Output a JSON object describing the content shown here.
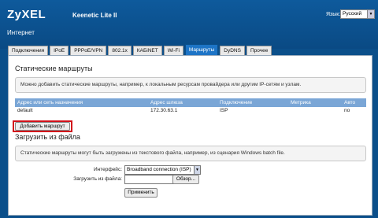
{
  "header": {
    "brand": "ZyXEL",
    "model": "Keenetic Lite II",
    "section": "Интернет",
    "language_label": "Язык:",
    "language_value": "Русский"
  },
  "tabs": [
    {
      "label": "Подключения"
    },
    {
      "label": "IPoE"
    },
    {
      "label": "PPPoE/VPN"
    },
    {
      "label": "802.1x"
    },
    {
      "label": "КАБiNET"
    },
    {
      "label": "Wi-Fi"
    },
    {
      "label": "Маршруты",
      "active": true
    },
    {
      "label": "DyDNS"
    },
    {
      "label": "Прочее"
    }
  ],
  "static_routes": {
    "title": "Статические маршруты",
    "info": "Можно добавить статические маршруты, например, к локальным ресурсам провайдера или другим IP-сетям и узлам.",
    "columns": [
      "Адрес или сеть назначения",
      "Адрес шлюза",
      "Подключение",
      "Метрика",
      "Авто"
    ],
    "rows": [
      [
        "default",
        "172.30.63.1",
        "ISP",
        "",
        "no"
      ]
    ],
    "add_button": "Добавить маршрут"
  },
  "file_upload": {
    "title": "Загрузить из файла",
    "info": "Статические маршруты могут быть загружены из текстового файла, например, из сценария Windows batch file.",
    "interface_label": "Интерфейс:",
    "interface_value": "Broadband connection (ISP)",
    "file_label": "Загрузить из файла:",
    "file_value": "",
    "browse_button": "Обзор...",
    "apply_button": "Применить"
  },
  "colors": {
    "header_bg": "#0b4f8a",
    "active_tab": "#1d74c6",
    "table_header": "#7aa6d6",
    "highlight": "#d2111a"
  }
}
